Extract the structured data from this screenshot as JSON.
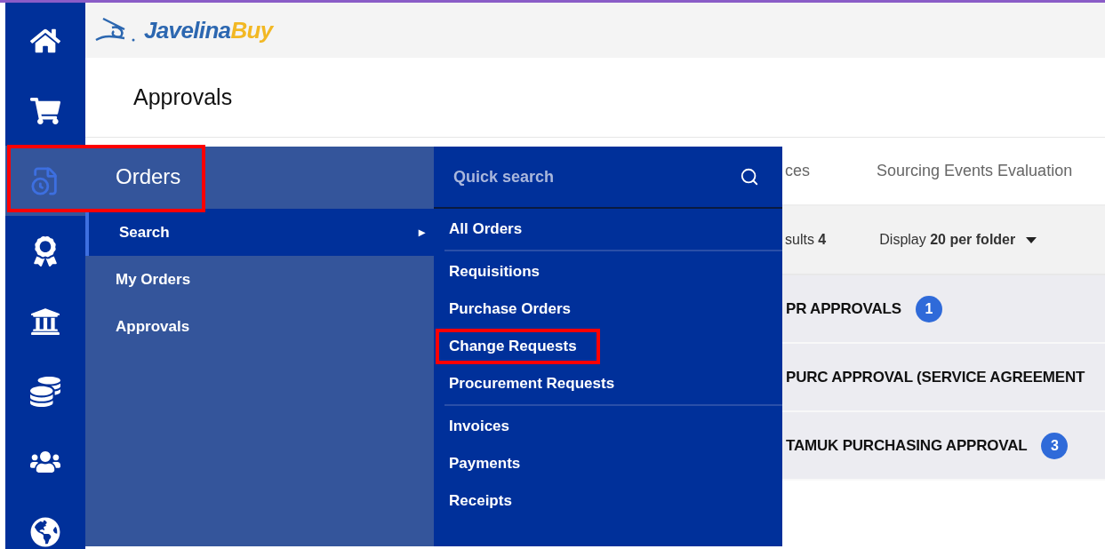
{
  "rail": [
    {
      "kind": "home",
      "selected": false,
      "highlighted": false
    },
    {
      "kind": "cart",
      "selected": false,
      "highlighted": false
    },
    {
      "kind": "orders",
      "selected": true,
      "highlighted": true
    },
    {
      "kind": "award",
      "selected": false,
      "highlighted": false
    },
    {
      "kind": "bank",
      "selected": false,
      "highlighted": false
    },
    {
      "kind": "money",
      "selected": false,
      "highlighted": false
    },
    {
      "kind": "users",
      "selected": false,
      "highlighted": false
    },
    {
      "kind": "globe",
      "selected": false,
      "highlighted": false
    }
  ],
  "logo": {
    "part_1": "Javelina",
    "part_2": "Buy"
  },
  "page_title": "Approvals",
  "tabs": [
    {
      "label": "ces",
      "selected": false
    },
    {
      "label": "Sourcing Events Evaluation",
      "selected": false
    }
  ],
  "results": {
    "label": "sults",
    "count": "4"
  },
  "display": {
    "label": "Display",
    "value": "20 per folder"
  },
  "folders": [
    {
      "name": "PR APPROVALS",
      "count": "1"
    },
    {
      "name": "PURC APPROVAL (SERVICE AGREEMENT"
    },
    {
      "name": "TAMUK PURCHASING APPROVAL",
      "count": "3"
    }
  ],
  "menu": {
    "title": "Orders",
    "items": [
      {
        "label": "Search",
        "selected": true,
        "caret": "▸"
      },
      {
        "label": "My Orders",
        "selected": false
      },
      {
        "label": "Approvals",
        "selected": false
      }
    ],
    "search": {
      "placeholder": "Quick search"
    },
    "groups": [
      [
        {
          "label": "All Orders",
          "highlighted": false
        }
      ],
      [
        {
          "label": "Requisitions",
          "highlighted": false
        },
        {
          "label": "Purchase Orders",
          "highlighted": false
        },
        {
          "label": "Change Requests",
          "highlighted": true
        },
        {
          "label": "Procurement Requests",
          "highlighted": false
        }
      ],
      [
        {
          "label": "Invoices",
          "highlighted": false
        },
        {
          "label": "Payments",
          "highlighted": false
        },
        {
          "label": "Receipts",
          "highlighted": false
        }
      ]
    ]
  }
}
